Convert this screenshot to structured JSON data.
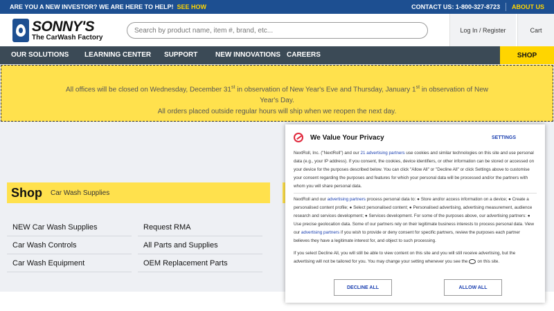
{
  "topbar": {
    "investor_text": "ARE YOU A NEW INVESTOR? WE ARE HERE TO HELP!",
    "see_how": "SEE HOW",
    "contact": "CONTACT US: 1-800-327-8723",
    "about": "ABOUT US"
  },
  "header": {
    "logo_main": "SONNY'S",
    "logo_sub": "The CarWash Factory",
    "search_placeholder": "Search by product name, item #, brand, etc...",
    "login": "Log In / Register",
    "cart": "Cart"
  },
  "nav": {
    "items": [
      "OUR SOLUTIONS",
      "LEARNING CENTER",
      "SUPPORT",
      "NEW INNOVATIONS",
      "CAREERS"
    ],
    "shop": "SHOP"
  },
  "notice": {
    "line1_a": "All offices will be closed on Wednesday, December 31",
    "line1_sup1": "st",
    "line1_b": " in observation of New Year's Eve and Thursday, January 1",
    "line1_sup2": "st",
    "line1_c": " in observation of New Year's Day.",
    "line2": "All orders placed outside regular hours will ship when we reopen the next day."
  },
  "shop": {
    "title": "Shop",
    "subtitle": "Car Wash Supplies",
    "links": [
      "NEW Car Wash Supplies",
      "Request RMA",
      "Car Wash Controls",
      "All Parts and Supplies",
      "Car Wash Equipment",
      "OEM Replacement Parts"
    ]
  },
  "privacy": {
    "title": "We Value Your Privacy",
    "settings": "SETTINGS",
    "p1_a": "NextRoll, Inc. (\"NextRoll\") and our ",
    "p1_link": "21 advertising partners",
    "p1_b": " use cookies and similar technologies on this site and use personal data (e.g., your IP address). If you consent, the cookies, device identifiers, or other information can be stored or accessed on your device for the purposes described below. You can click \"Allow All\" or \"Decline All\" or click Settings above to customise your consent regarding the purposes and features for which your personal data will be processed and/or the partners with whom you will share personal data.",
    "p2_a": "NextRoll and our ",
    "p2_link": "advertising partners",
    "p2_b": " process personal data to: ● Store and/or access information on a device; ● Create a personalised content profile; ● Select personalised content; ● Personalised advertising, advertising measurement, audience research and services development; ● Services development. For some of the purposes above, our advertising partners: ● Use precise geolocation data. Some of our partners rely on their legitimate business interests to process personal data. View our ",
    "p2_link2": "advertising partners",
    "p2_c": " if you wish to provide or deny consent for specific partners, review the purposes each partner believes they have a legitimate interest for, and object to such processing.",
    "p3_a": "If you select Decline All, you will still be able to view content on this site and you will still receive advertising, but the advertising will not be tailored for you. You may change your setting whenever you see the",
    "p3_b": "on this site.",
    "decline": "DECLINE ALL",
    "allow": "ALLOW ALL"
  },
  "colors": {
    "topbar": "#1d4f91",
    "accent_yellow": "#ffd500",
    "nav": "#3b4a56",
    "link_blue": "#1a3fb0",
    "privacy_icon": "#e0263a"
  }
}
